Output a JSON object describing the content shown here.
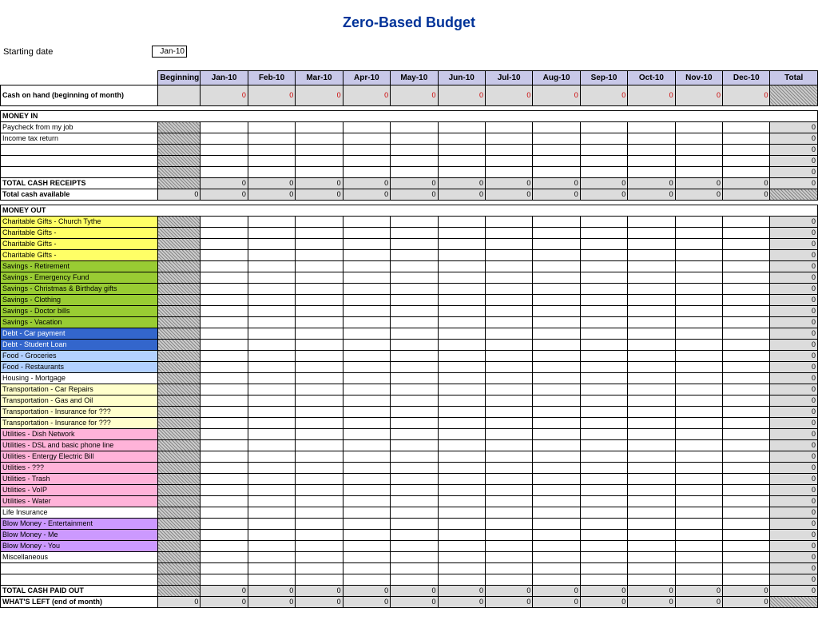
{
  "title": "Zero-Based Budget",
  "starting_date_label": "Starting date",
  "starting_date_value": "Jan-10",
  "columns": {
    "label_blank": "",
    "beginning": "Beginning",
    "months": [
      "Jan-10",
      "Feb-10",
      "Mar-10",
      "Apr-10",
      "May-10",
      "Jun-10",
      "Jul-10",
      "Aug-10",
      "Sep-10",
      "Oct-10",
      "Nov-10",
      "Dec-10"
    ],
    "total": "Total"
  },
  "cash_on_hand_label": "Cash on hand (beginning of month)",
  "money_in": {
    "header": "MONEY IN",
    "rows": [
      "Paycheck from my job",
      "Income tax return",
      "",
      "",
      ""
    ],
    "total_receipts": "TOTAL CASH RECEIPTS",
    "total_available": "Total cash available"
  },
  "money_out": {
    "header": "MONEY OUT",
    "rows": [
      {
        "label": "Charitable Gifts - Church Tythe",
        "color": "c-yellow"
      },
      {
        "label": "Charitable Gifts -",
        "color": "c-yellow"
      },
      {
        "label": "Charitable Gifts -",
        "color": "c-yellow"
      },
      {
        "label": "Charitable Gifts -",
        "color": "c-yellow"
      },
      {
        "label": "Savings - Retirement",
        "color": "c-green"
      },
      {
        "label": "Savings - Emergency Fund",
        "color": "c-green"
      },
      {
        "label": "Savings - Christmas & Birthday gifts",
        "color": "c-green"
      },
      {
        "label": "Savings - Clothing",
        "color": "c-green"
      },
      {
        "label": "Savings - Doctor bills",
        "color": "c-green"
      },
      {
        "label": "Savings - Vacation",
        "color": "c-green"
      },
      {
        "label": "Debt - Car payment",
        "color": "c-darkblue"
      },
      {
        "label": "Debt - Student Loan",
        "color": "c-darkblue"
      },
      {
        "label": "Food - Groceries",
        "color": "c-lightblue"
      },
      {
        "label": "Food - Restaurants",
        "color": "c-lightblue"
      },
      {
        "label": "Housing - Mortgage",
        "color": "c-nocolor"
      },
      {
        "label": "Transportation - Car Repairs",
        "color": "c-cream"
      },
      {
        "label": "Transportation - Gas and Oil",
        "color": "c-cream"
      },
      {
        "label": "Transportation - Insurance for ???",
        "color": "c-cream"
      },
      {
        "label": "Transportation - Insurance for ???",
        "color": "c-cream"
      },
      {
        "label": "Utilities - Dish Network",
        "color": "c-pink"
      },
      {
        "label": "Utilities - DSL and basic phone line",
        "color": "c-pink"
      },
      {
        "label": "Utilities - Entergy Electric Bill",
        "color": "c-pink"
      },
      {
        "label": "Utilities - ???",
        "color": "c-pink"
      },
      {
        "label": "Utilities - Trash",
        "color": "c-pink"
      },
      {
        "label": "Utilities - VoIP",
        "color": "c-pink"
      },
      {
        "label": "Utilities - Water",
        "color": "c-pink"
      },
      {
        "label": "Life Insurance",
        "color": "c-nocolor"
      },
      {
        "label": "Blow Money - Entertainment",
        "color": "c-purple"
      },
      {
        "label": "Blow Money - Me",
        "color": "c-purple"
      },
      {
        "label": "Blow Money - You",
        "color": "c-purple"
      },
      {
        "label": "Miscellaneous",
        "color": "c-nocolor"
      },
      {
        "label": "",
        "color": "c-nocolor"
      },
      {
        "label": "",
        "color": "c-nocolor"
      }
    ],
    "total_paid_out": "TOTAL CASH PAID OUT",
    "whats_left": "WHAT'S LEFT (end of month)"
  },
  "zero": "0"
}
